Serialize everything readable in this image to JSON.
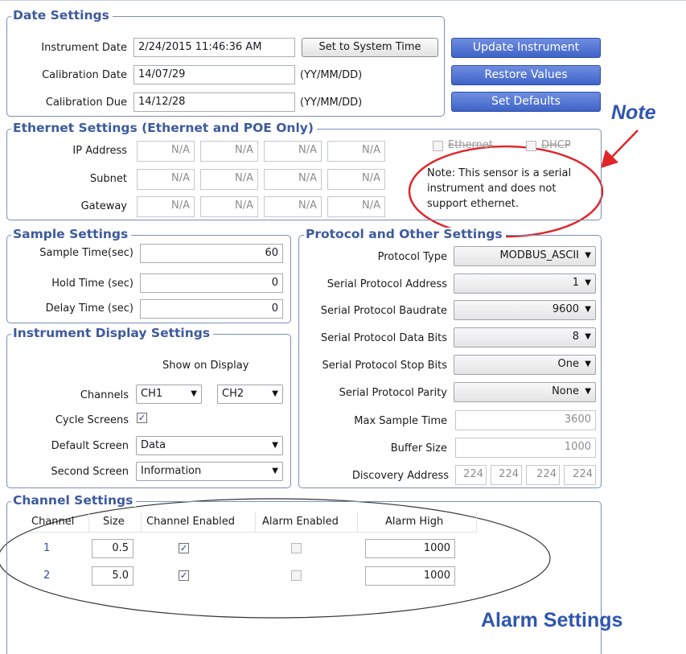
{
  "date_settings": {
    "title": "Date Settings",
    "instrument_date_label": "Instrument Date",
    "instrument_date_value": "2/24/2015 11:46:36 AM",
    "set_system_time_label": "Set to System Time",
    "calibration_date_label": "Calibration Date",
    "calibration_date_value": "14/07/29",
    "calibration_date_hint": "(YY/MM/DD)",
    "calibration_due_label": "Calibration Due",
    "calibration_due_value": "14/12/28",
    "calibration_due_hint": "(YY/MM/DD)"
  },
  "actions": {
    "update_instrument": "Update Instrument",
    "restore_values": "Restore Values",
    "set_defaults": "Set Defaults"
  },
  "annotations": {
    "note": "Note",
    "alarm_settings": "Alarm Settings"
  },
  "ethernet": {
    "title": "Ethernet Settings (Ethernet and POE Only)",
    "ip_label": "IP Address",
    "subnet_label": "Subnet",
    "gateway_label": "Gateway",
    "na": "N/A",
    "ethernet_checkbox": "Ethernet",
    "dhcp_checkbox": "DHCP",
    "note_line1": "Note: This sensor is a serial",
    "note_line2": "instrument and does not",
    "note_line3": "support ethernet."
  },
  "sample": {
    "title": "Sample Settings",
    "sample_time_label": "Sample Time(sec)",
    "sample_time_value": "60",
    "hold_time_label": "Hold Time (sec)",
    "hold_time_value": "0",
    "delay_time_label": "Delay Time (sec)",
    "delay_time_value": "0"
  },
  "display": {
    "title": "Instrument Display Settings",
    "show_on_display": "Show on Display",
    "channels_label": "Channels",
    "channel_a": "CH1",
    "channel_b": "CH2",
    "cycle_label": "Cycle Screens",
    "cycle_checked": true,
    "default_screen_label": "Default Screen",
    "default_screen_value": "Data",
    "second_screen_label": "Second Screen",
    "second_screen_value": "Information"
  },
  "protocol": {
    "title": "Protocol and Other Settings",
    "type_label": "Protocol Type",
    "type_value": "MODBUS_ASCII",
    "address_label": "Serial Protocol Address",
    "address_value": "1",
    "baud_label": "Serial Protocol Baudrate",
    "baud_value": "9600",
    "data_bits_label": "Serial Protocol Data Bits",
    "data_bits_value": "8",
    "stop_bits_label": "Serial Protocol Stop Bits",
    "stop_bits_value": "One",
    "parity_label": "Serial Protocol Parity",
    "parity_value": "None",
    "max_sample_label": "Max Sample Time",
    "max_sample_value": "3600",
    "buffer_label": "Buffer Size",
    "buffer_value": "1000",
    "discovery_label": "Discovery Address",
    "discovery_octets": [
      "224",
      "224",
      "224",
      "224"
    ]
  },
  "channel_settings": {
    "title": "Channel Settings",
    "headers": [
      "Channel",
      "Size",
      "Channel Enabled",
      "Alarm Enabled",
      "Alarm High"
    ],
    "rows": [
      {
        "channel": "1",
        "size": "0.5",
        "channel_enabled": true,
        "alarm_enabled": false,
        "alarm_high": "1000"
      },
      {
        "channel": "2",
        "size": "5.0",
        "channel_enabled": true,
        "alarm_enabled": false,
        "alarm_high": "1000"
      }
    ]
  },
  "colors": {
    "accent": "#3d5a9e",
    "button_blue": "#4a6cd0",
    "annotation_red": "#e0262a",
    "annotation_blue": "#2f56b0"
  },
  "icons": {
    "dropdown": "chevron-down-icon",
    "checkmark": "checkmark-icon"
  }
}
